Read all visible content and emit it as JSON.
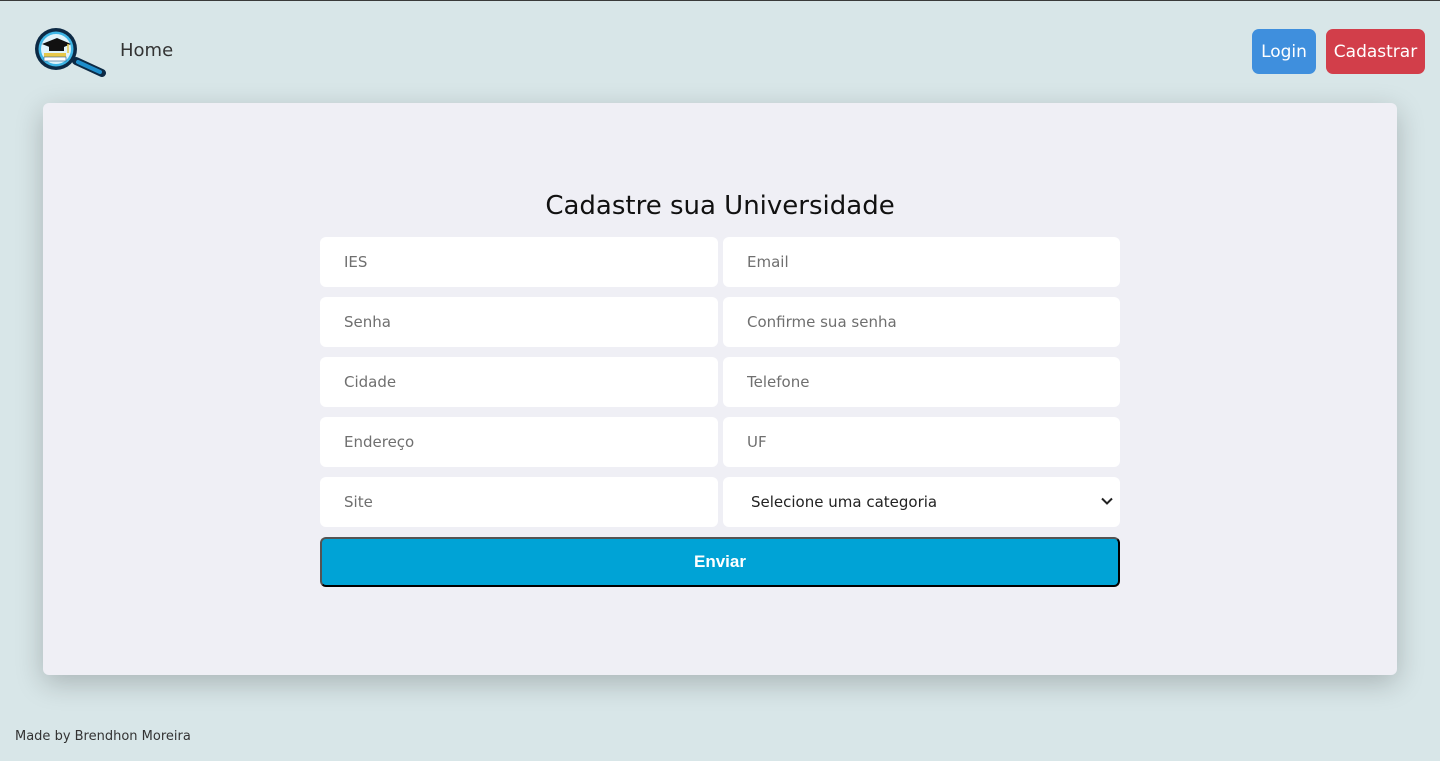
{
  "nav": {
    "home_label": "Home",
    "login_label": "Login",
    "signup_label": "Cadastrar",
    "logo_icon": "magnifier-graduation-cap-logo-icon"
  },
  "form": {
    "title": "Cadastre sua Universidade",
    "fields": {
      "ies": {
        "placeholder": "IES",
        "value": ""
      },
      "email": {
        "placeholder": "Email",
        "value": ""
      },
      "senha": {
        "placeholder": "Senha",
        "value": ""
      },
      "confirme_senha": {
        "placeholder": "Confirme sua senha",
        "value": ""
      },
      "cidade": {
        "placeholder": "Cidade",
        "value": ""
      },
      "telefone": {
        "placeholder": "Telefone",
        "value": ""
      },
      "endereco": {
        "placeholder": "Endereço",
        "value": ""
      },
      "uf": {
        "placeholder": "UF",
        "value": ""
      },
      "site": {
        "placeholder": "Site",
        "value": ""
      }
    },
    "categoria_selected": "Selecione uma categoria",
    "submit_label": "Enviar"
  },
  "footer": {
    "credit": "Made by Brendhon Moreira"
  },
  "colors": {
    "page_bg": "#d8e6e8",
    "card_bg": "#efeff5",
    "login_btn": "#3f8fdd",
    "signup_btn": "#d23e4a",
    "submit_btn": "#00a3d6"
  }
}
